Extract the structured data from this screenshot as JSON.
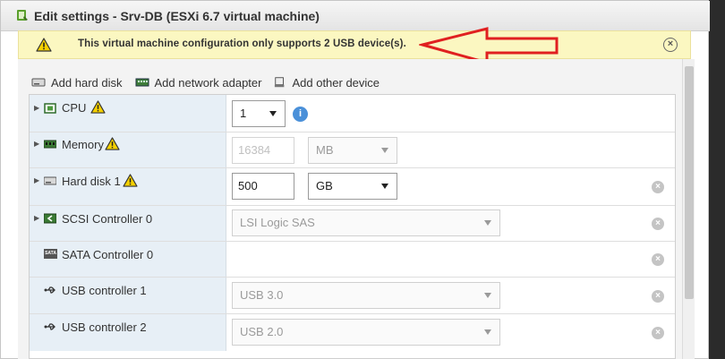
{
  "dialog": {
    "title": "Edit settings - Srv-DB (ESXi 6.7 virtual machine)"
  },
  "banner": {
    "message": "This virtual machine configuration only supports 2 USB device(s).",
    "close_glyph": "×",
    "color": "#fbf7c1"
  },
  "annotation": {
    "arrow_color": "#e02020"
  },
  "toolbar": {
    "add_hard_disk": "Add hard disk",
    "add_network_adapter": "Add network adapter",
    "add_other_device": "Add other device"
  },
  "hardware": {
    "cpu": {
      "label": "CPU",
      "value": "1",
      "info_glyph": "i"
    },
    "memory": {
      "label": "Memory",
      "value": "16384",
      "unit": "MB"
    },
    "hard_disk": {
      "label": "Hard disk 1",
      "value": "500",
      "unit": "GB"
    },
    "scsi": {
      "label": "SCSI Controller 0",
      "value": "LSI Logic SAS"
    },
    "sata": {
      "label": "SATA Controller 0",
      "icon_text": "SATA"
    },
    "usb1": {
      "label": "USB controller 1",
      "value": "USB 3.0"
    },
    "usb2": {
      "label": "USB controller 2",
      "value": "USB 2.0"
    }
  },
  "remove_glyph": "×"
}
